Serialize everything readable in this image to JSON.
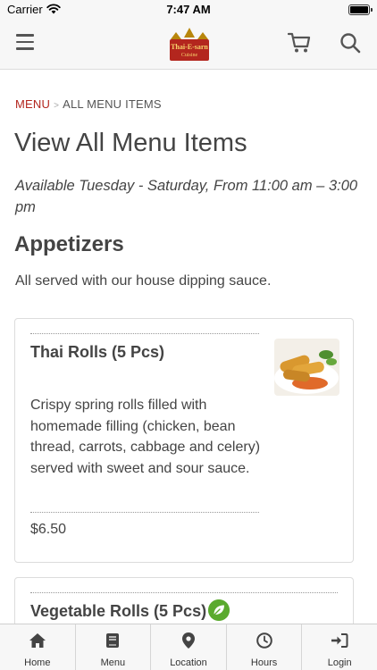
{
  "status_bar": {
    "carrier": "Carrier",
    "time": "7:47 AM",
    "icons": [
      "wifi-icon",
      "battery-icon"
    ]
  },
  "header": {
    "logo_text": "Thai-E-sarn",
    "logo_subtext": "Cuisine",
    "icons": [
      "hamburger-menu-icon",
      "cart-icon",
      "search-icon"
    ]
  },
  "breadcrumb": {
    "menu": "MENU",
    "current": "ALL MENU ITEMS"
  },
  "page": {
    "title": "View All Menu Items",
    "availability": "Available Tuesday - Saturday, From 11:00 am – 3:00 pm"
  },
  "section": {
    "title": "Appetizers",
    "description": "All served with our house dipping sauce."
  },
  "items": [
    {
      "name": "Thai Rolls (5 Pcs)",
      "description": "Crispy spring rolls filled with homemade filling (chicken, bean thread, carrots, cabbage and celery) served with sweet and sour sauce.",
      "price": "$6.50",
      "photo": "spring-rolls-photo"
    },
    {
      "name": "Vegetable Rolls (5 Pcs)",
      "badge_icon": "vegetarian-leaf-icon"
    }
  ],
  "tabs": [
    {
      "label": "Home",
      "icon": "home-icon"
    },
    {
      "label": "Menu",
      "icon": "menu-book-icon"
    },
    {
      "label": "Location",
      "icon": "location-pin-icon"
    },
    {
      "label": "Hours",
      "icon": "clock-icon"
    },
    {
      "label": "Login",
      "icon": "login-icon"
    }
  ],
  "colors": {
    "accent": "#b3261e",
    "veg_badge": "#5aaa2e",
    "bar_background": "#f7f7f7"
  }
}
